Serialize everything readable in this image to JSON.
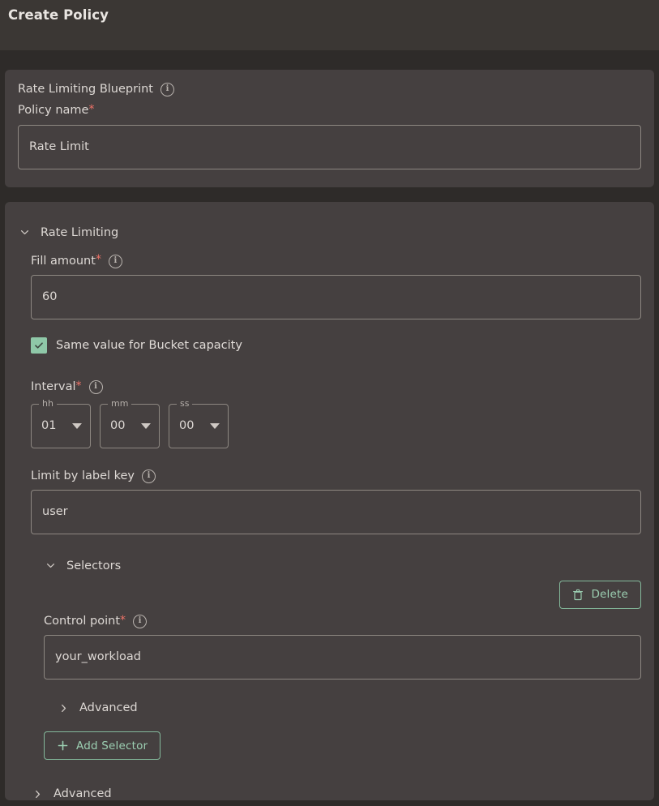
{
  "header": {
    "title": "Create Policy"
  },
  "blueprint_card": {
    "title": "Rate Limiting Blueprint",
    "info_icon": "info-icon",
    "policy_name": {
      "label": "Policy name",
      "required_marker": "*",
      "value": "Rate Limit",
      "placeholder": "Policy name"
    }
  },
  "rate_limiting": {
    "section_label": "Rate Limiting",
    "chevron": "chevron-down-icon",
    "fill_amount": {
      "label": "Fill amount",
      "required_marker": "*",
      "value": "60",
      "placeholder": "Fill amount"
    },
    "same_value_checkbox": {
      "label": "Same value for Bucket capacity",
      "checked": true
    },
    "interval": {
      "label": "Interval",
      "required_marker": "*",
      "units": [
        {
          "legend": "hh",
          "value": "01"
        },
        {
          "legend": "mm",
          "value": "00"
        },
        {
          "legend": "ss",
          "value": "00"
        }
      ]
    },
    "limit_by_label_key": {
      "label": "Limit by label key",
      "value": "user",
      "placeholder": "Limit by label key"
    },
    "selectors": {
      "section_label": "Selectors",
      "chevron": "chevron-down-icon",
      "delete_button": {
        "label": "Delete",
        "icon": "trash-icon"
      },
      "control_point": {
        "label": "Control point",
        "required_marker": "*",
        "value": "your_workload",
        "placeholder": "Control point"
      },
      "advanced": {
        "label": "Advanced",
        "chevron": "chevron-right-icon"
      },
      "add_selector_button": {
        "label": "Add Selector",
        "icon": "plus-icon"
      }
    },
    "advanced": {
      "label": "Advanced",
      "chevron": "chevron-right-icon"
    }
  },
  "colors": {
    "page_background": "#2e2b29",
    "header_background": "#3b3734",
    "card_background": "#454040",
    "accent_green": "#8fc8a8",
    "button_green": "#9ccfb2",
    "required_red": "#ef7368",
    "border_gray": "#8d8781",
    "text_primary": "#ddd8d4"
  }
}
